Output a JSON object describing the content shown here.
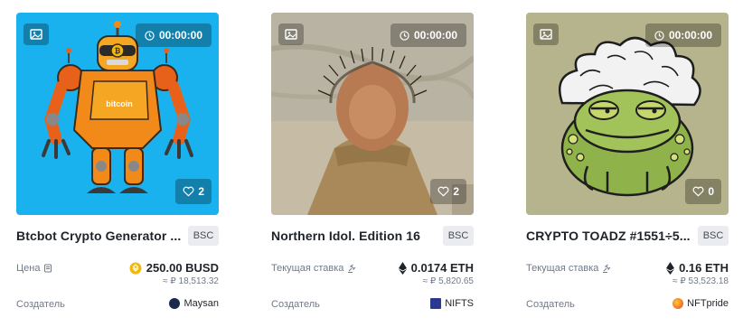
{
  "cards": [
    {
      "title": "Btcbot Crypto Generator ...",
      "chain": "BSC",
      "timer": "00:00:00",
      "likes": "2",
      "price_label": "Цена",
      "price": "250.00 BUSD",
      "fiat": "≈ ₽ 18,513.32",
      "creator_label": "Создатель",
      "creator": "Maysan",
      "currency_icon": "busd-coin-icon"
    },
    {
      "title": "Northern Idol. Edition 16",
      "chain": "BSC",
      "timer": "00:00:00",
      "likes": "2",
      "price_label": "Текущая ставка",
      "price": "0.0174 ETH",
      "fiat": "≈ ₽ 5,820.65",
      "creator_label": "Создатель",
      "creator": "NIFTS",
      "currency_icon": "eth-icon"
    },
    {
      "title": "CRYPTO TOADZ #1551÷5...",
      "chain": "BSC",
      "timer": "00:00:00",
      "likes": "0",
      "price_label": "Текущая ставка",
      "price": "0.16 ETH",
      "fiat": "≈ ₽ 53,523.18",
      "creator_label": "Создатель",
      "creator": "NFTpride",
      "currency_icon": "eth-icon"
    }
  ],
  "artwork": {
    "robot_chest_text": "bitcoin"
  },
  "colors": {
    "busd": "#f0b90b",
    "text": "#1e2329",
    "muted": "#707a8a"
  }
}
